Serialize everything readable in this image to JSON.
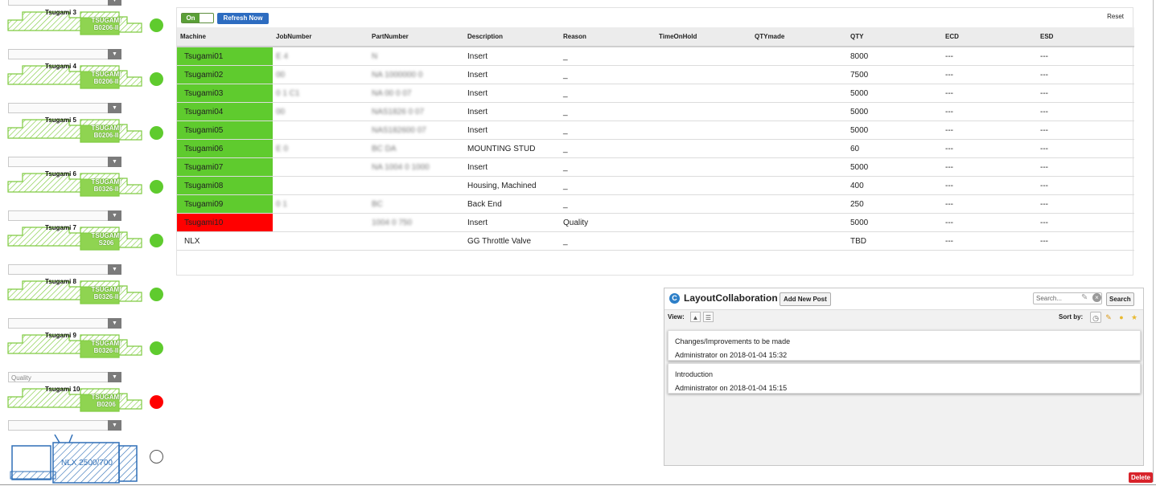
{
  "colors": {
    "ok": "#5fcb2e",
    "down": "#ff0000",
    "shape_green": "#7fcb40",
    "shape_blue": "#2f6fb7"
  },
  "machines": [
    {
      "name": "Tsugami 3",
      "model": "TSUGAMI B0206-II",
      "reason": "",
      "status": "green"
    },
    {
      "name": "Tsugami 4",
      "model": "TSUGAMI B0206-II",
      "reason": "",
      "status": "green"
    },
    {
      "name": "Tsugami 5",
      "model": "TSUGAMI B0206-II",
      "reason": "",
      "status": "green"
    },
    {
      "name": "Tsugami 6",
      "model": "TSUGAMI B0326-II",
      "reason": "",
      "status": "green"
    },
    {
      "name": "Tsugami 7",
      "model": "TSUGAMI S206",
      "reason": "",
      "status": "green"
    },
    {
      "name": "Tsugami 8",
      "model": "TSUGAMI B0326-II",
      "reason": "",
      "status": "green"
    },
    {
      "name": "Tsugami 9",
      "model": "TSUGAMI B0326-II",
      "reason": "",
      "status": "green"
    },
    {
      "name": "Tsugami 10",
      "model": "TSUGAMI B0206",
      "reason": "Quality",
      "status": "red"
    }
  ],
  "nlx": {
    "label": "NLX 2500/700",
    "status": "empty"
  },
  "toolbar": {
    "toggle_label": "On",
    "refresh_label": "Refresh Now",
    "reset_label": "Reset"
  },
  "table": {
    "headers": [
      "Machine",
      "JobNumber",
      "PartNumber",
      "Description",
      "Reason",
      "TimeOnHold",
      "QTYmade",
      "QTY",
      "ECD",
      "ESD"
    ],
    "rows": [
      {
        "machine": "Tsugami01",
        "job": "E        4",
        "part": "N                   ",
        "desc": "Insert",
        "reason": "_",
        "hold": "",
        "made": "",
        "qty": "8000",
        "ecd": "---",
        "esd": "---",
        "status": "green"
      },
      {
        "machine": "Tsugami02",
        "job": "00",
        "part": "NA    1000000 0",
        "desc": "Insert",
        "reason": "_",
        "hold": "",
        "made": "",
        "qty": "7500",
        "ecd": "---",
        "esd": "---",
        "status": "green"
      },
      {
        "machine": "Tsugami03",
        "job": "0       1 C1",
        "part": "NA    00 0 07",
        "desc": "Insert",
        "reason": "_",
        "hold": "",
        "made": "",
        "qty": "5000",
        "ecd": "---",
        "esd": "---",
        "status": "green"
      },
      {
        "machine": "Tsugami04",
        "job": "00",
        "part": "NAS1826 0 07",
        "desc": "Insert",
        "reason": "_",
        "hold": "",
        "made": "",
        "qty": "5000",
        "ecd": "---",
        "esd": "---",
        "status": "green"
      },
      {
        "machine": "Tsugami05",
        "job": "",
        "part": "NAS182600 07",
        "desc": "Insert",
        "reason": "_",
        "hold": "",
        "made": "",
        "qty": "5000",
        "ecd": "---",
        "esd": "---",
        "status": "green"
      },
      {
        "machine": "Tsugami06",
        "job": "E       0",
        "part": "BC         DA",
        "desc": "MOUNTING STUD",
        "reason": "_",
        "hold": "",
        "made": "",
        "qty": "60",
        "ecd": "---",
        "esd": "---",
        "status": "green"
      },
      {
        "machine": "Tsugami07",
        "job": "",
        "part": "NA    1004 0 1000",
        "desc": "Insert",
        "reason": "_",
        "hold": "",
        "made": "",
        "qty": "5000",
        "ecd": "---",
        "esd": "---",
        "status": "green"
      },
      {
        "machine": "Tsugami08",
        "job": "",
        "part": "",
        "desc": "Housing, Machined",
        "reason": "_",
        "hold": "",
        "made": "",
        "qty": "400",
        "ecd": "---",
        "esd": "---",
        "status": "green"
      },
      {
        "machine": "Tsugami09",
        "job": "0        1",
        "part": "BC",
        "desc": "Back End",
        "reason": "_",
        "hold": "",
        "made": "",
        "qty": "250",
        "ecd": "---",
        "esd": "---",
        "status": "green"
      },
      {
        "machine": "Tsugami10",
        "job": "",
        "part": "     1004 0 750",
        "desc": "Insert",
        "reason": "Quality",
        "hold": "",
        "made": "",
        "qty": "5000",
        "ecd": "---",
        "esd": "---",
        "status": "red"
      },
      {
        "machine": "NLX",
        "job": "",
        "part": "",
        "desc": "GG Throttle Valve",
        "reason": "_",
        "hold": "",
        "made": "",
        "qty": "TBD",
        "ecd": "---",
        "esd": "---",
        "status": "none"
      }
    ]
  },
  "collab": {
    "title": "LayoutCollaboration",
    "add_label": "Add New Post",
    "search_placeholder": "Search...",
    "search_label": "Search",
    "view_label": "View:",
    "sort_label": "Sort by:",
    "posts": [
      {
        "title": "Changes/Improvements to be made",
        "meta": "Administrator on 2018-01-04 15:32"
      },
      {
        "title": "Introduction",
        "meta": "Administrator on 2018-01-04 15:15"
      }
    ]
  },
  "delete_label": "Delete"
}
